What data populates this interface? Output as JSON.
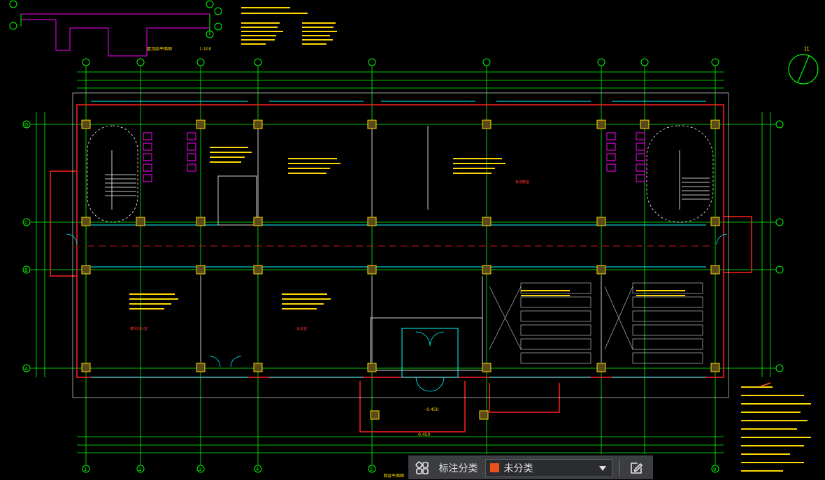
{
  "drawing": {
    "grid_axes_bottom": [
      "1",
      "2",
      "3",
      "4",
      "5",
      "6",
      "7",
      "8",
      "9"
    ],
    "grid_axes_side": [
      "D",
      "C",
      "B",
      "A"
    ],
    "title_bottom": "首层平面图",
    "mini_plan_title": "屋顶层平面图",
    "mini_plan_scale": "1:100",
    "room_label_a": "教师办公室",
    "room_label_b": "会议室",
    "room_label_c": "普通教室",
    "elev_label_1": "-0.450",
    "elev_label_2": "-0.450",
    "north_label": "北",
    "colors": {
      "background": "#000000",
      "axis": "#00ff00",
      "wall": "#ff2020",
      "window": "#00ffff",
      "column": "#ffff00",
      "partition": "#ff00ff",
      "text": "#ffd700",
      "dim": "#ffffff"
    }
  },
  "toolbar": {
    "grid_icon": "grid-view-icon",
    "label": "标注分类",
    "select_value": "未分类",
    "select_swatch_color": "#e8501c",
    "edit_icon": "edit-note-icon"
  }
}
